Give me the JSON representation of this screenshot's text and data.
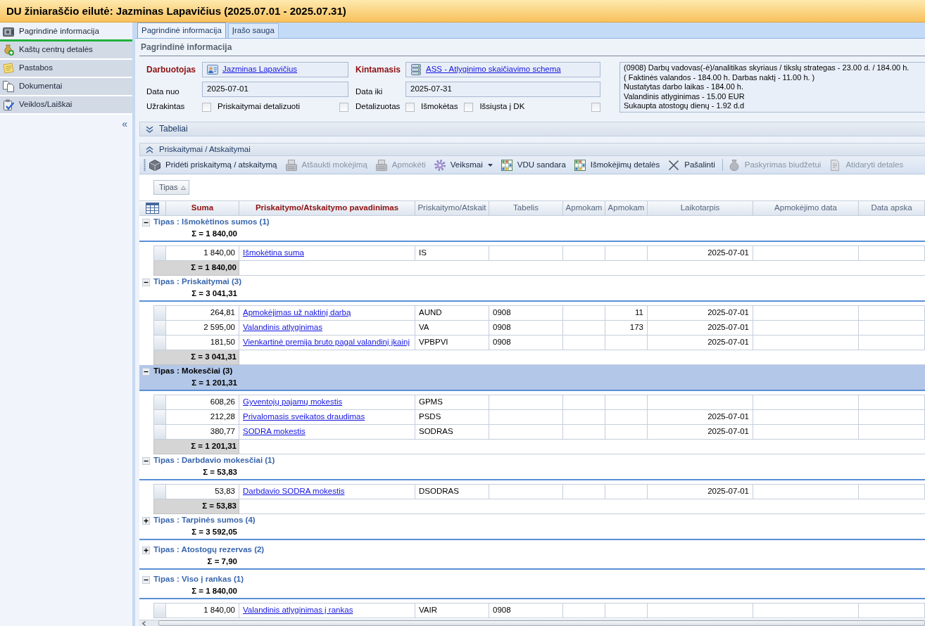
{
  "window": {
    "title": "DU žiniaraščio eilutė: Jazminas Lapavičius (2025.07.01 - 2025.07.31)"
  },
  "sidebar": {
    "items": [
      {
        "label": "Pagrindinė informacija",
        "selected": true
      },
      {
        "label": "Kaštų centrų detalės",
        "selected": false
      },
      {
        "label": "Pastabos",
        "selected": false
      },
      {
        "label": "Dokumentai",
        "selected": false
      },
      {
        "label": "Veiklos/Laiškai",
        "selected": false
      }
    ],
    "collapse_button": "«"
  },
  "tabs": [
    {
      "label": "Pagrindinė informacija",
      "selected": true
    },
    {
      "label": "Įrašo sauga",
      "selected": false
    }
  ],
  "section_title": "Pagrindinė informacija",
  "form": {
    "employee": {
      "label": "Darbuotojas",
      "value": "Jazminas Lapavičius"
    },
    "variable": {
      "label": "Kintamasis",
      "value": "ASS - Atlyginimo skaičiavimo schema"
    },
    "date_from": {
      "label": "Data nuo",
      "value": "2025-07-01"
    },
    "date_to": {
      "label": "Data iki",
      "value": "2025-07-31"
    },
    "checkboxes": [
      {
        "label": "Užrakintas",
        "checked": false
      },
      {
        "label": "Priskaitymai detalizuoti",
        "checked": false
      },
      {
        "label": "Detalizuotas",
        "checked": false
      },
      {
        "label": "Išmokėtas",
        "checked": false
      },
      {
        "label": "Išsiųsta į DK",
        "checked": false
      }
    ],
    "summary_lines": [
      "(0908) Darbų vadovas(-ė)/analitikas skyriaus / tikslų strategas - 23.00 d. / 184.00 h.",
      "( Faktinės valandos - 184.00 h. Darbas naktį - 11.00 h. )",
      "Nustatytas darbo laikas - 184.00 h.",
      "Valandinis atlyginimas - 15.00 EUR",
      "Sukaupta atostogų dienų - 1.92 d.d"
    ]
  },
  "panels": [
    {
      "title": "Tabeliai",
      "expanded": false
    },
    {
      "title": "Priskaitymai / Atskaitymai",
      "expanded": true,
      "toolbar": [
        {
          "kind": "button",
          "label": "Pridėti priskaitymą / atskaitymą",
          "disabled": false
        },
        {
          "kind": "button",
          "label": "Atšaukti mokėjimą",
          "disabled": true
        },
        {
          "kind": "button",
          "label": "Apmokėti",
          "disabled": true
        },
        {
          "kind": "dropdown",
          "label": "Veiksmai",
          "disabled": false
        },
        {
          "kind": "button",
          "label": "VDU sandara",
          "disabled": false
        },
        {
          "kind": "button",
          "label": "Išmokėjimų detalės",
          "disabled": false
        },
        {
          "kind": "button",
          "label": "Pašalinti",
          "disabled": false
        },
        {
          "kind": "separator"
        },
        {
          "kind": "button",
          "label": "Paskyrimas biudžetui",
          "disabled": true
        },
        {
          "kind": "button",
          "label": "Atidaryti detales",
          "disabled": true
        }
      ],
      "group_by": [
        {
          "label": "Tipas"
        }
      ],
      "grid": {
        "columns": [
          {
            "label": "Suma",
            "emphasized": true
          },
          {
            "label": "Priskaitymo/Atskaitymo pavadinimas",
            "emphasized": true
          },
          {
            "label": "Priskaitymo/Atskait",
            "emphasized": false
          },
          {
            "label": "Tabelis",
            "emphasized": false
          },
          {
            "label": "Apmokam",
            "emphasized": false
          },
          {
            "label": "Apmokam",
            "emphasized": false
          },
          {
            "label": "Laikotarpis",
            "emphasized": false
          },
          {
            "label": "Apmokėjimo data",
            "emphasized": false
          },
          {
            "label": "Data apska",
            "emphasized": false
          }
        ],
        "groups": [
          {
            "title": "Tipas : Išmokėtinos sumos (1)",
            "sum": "Σ = 1 840,00",
            "expanded": true,
            "selected": false,
            "rows": [
              {
                "amount": "1 840,00",
                "name": "Išmokėtina suma",
                "code": "IS",
                "period": "2025-07-01"
              }
            ],
            "footer": "Σ = 1 840,00"
          },
          {
            "title": "Tipas : Priskaitymai (3)",
            "sum": "Σ = 3 041,31",
            "expanded": true,
            "selected": false,
            "rows": [
              {
                "amount": "264,81",
                "name": "Apmokėjimas už naktinį darbą",
                "code": "AUND",
                "timesheet": "0908",
                "column_6": "11",
                "period": "2025-07-01"
              },
              {
                "amount": "2 595,00",
                "name": "Valandinis atlyginimas",
                "code": "VA",
                "timesheet": "0908",
                "column_6": "173",
                "period": "2025-07-01"
              },
              {
                "amount": "181,50",
                "name": "Vienkartinė premija bruto pagal valandinį įkainį",
                "code": "VPBPVI",
                "timesheet": "0908",
                "period": "2025-07-01"
              }
            ],
            "footer": "Σ = 3 041,31"
          },
          {
            "title": "Tipas : Mokesčiai (3)",
            "sum": "Σ = 1 201,31",
            "expanded": true,
            "selected": true,
            "rows": [
              {
                "amount": "608,26",
                "name": "Gyventojų pajamų mokestis",
                "code": "GPMS"
              },
              {
                "amount": "212,28",
                "name": "Privalomasis sveikatos draudimas",
                "code": "PSDS",
                "period": "2025-07-01"
              },
              {
                "amount": "380,77",
                "name": "SODRA mokestis",
                "code": "SODRAS",
                "period": "2025-07-01"
              }
            ],
            "footer": "Σ = 1 201,31"
          },
          {
            "title": "Tipas : Darbdavio mokesčiai (1)",
            "sum": "Σ = 53,83",
            "expanded": true,
            "selected": false,
            "rows": [
              {
                "amount": "53,83",
                "name": "Darbdavio SODRA mokestis",
                "code": "DSODRAS",
                "period": "2025-07-01"
              }
            ],
            "footer": "Σ = 53,83"
          },
          {
            "title": "Tipas : Tarpinės sumos (4)",
            "sum": "Σ = 3 592,05",
            "expanded": false,
            "selected": false
          },
          {
            "title": "Tipas : Atostogų rezervas (2)",
            "sum": "Σ = 7,90",
            "expanded": false,
            "selected": false
          },
          {
            "title": "Tipas : Viso į rankas (1)",
            "sum": "Σ = 1 840,00",
            "expanded": true,
            "selected": false,
            "rows": [
              {
                "amount": "1 840,00",
                "name": "Valandinis atlyginimas į rankas",
                "code": "VAIR",
                "timesheet": "0908"
              }
            ]
          }
        ]
      }
    }
  ]
}
